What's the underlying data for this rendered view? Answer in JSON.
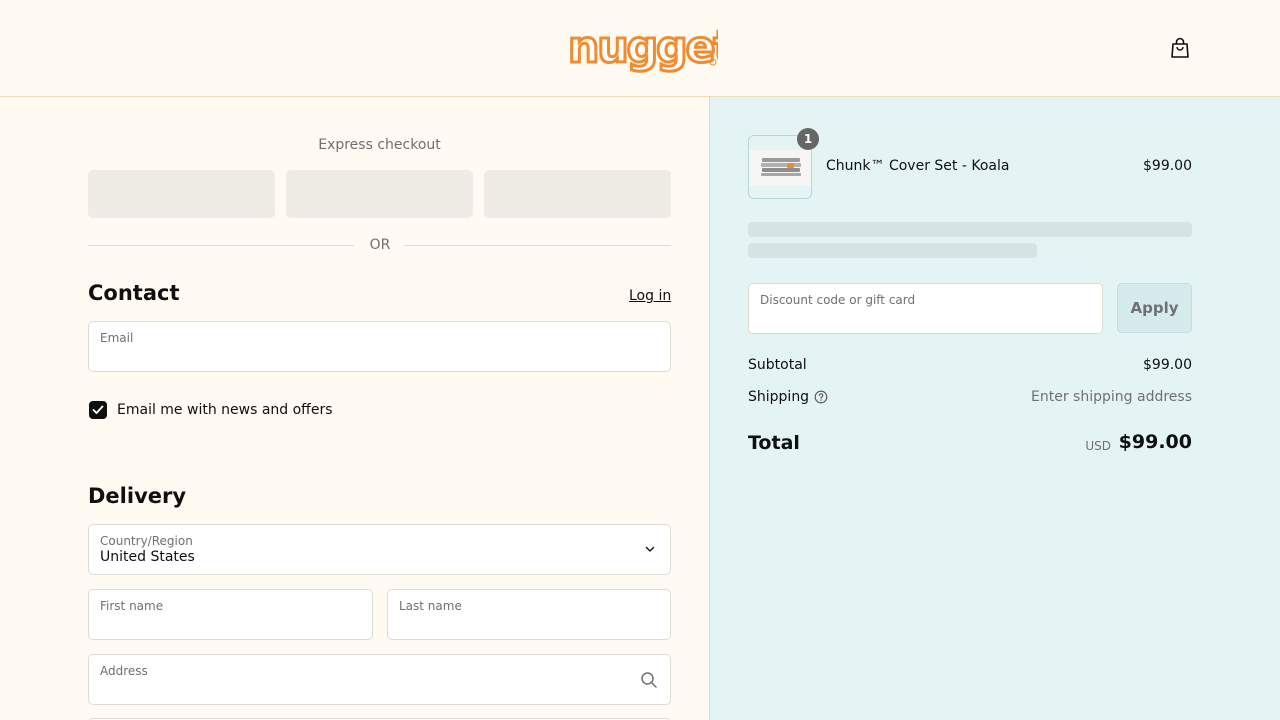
{
  "header": {
    "logo_text": "nugget",
    "cart_icon": "shopping-bag-icon"
  },
  "express": {
    "title": "Express checkout",
    "or_label": "OR"
  },
  "contact": {
    "title": "Contact",
    "login_label": "Log in",
    "email_label": "Email",
    "email_value": "",
    "newsletter_label": "Email me with news and offers",
    "newsletter_checked": true
  },
  "delivery": {
    "title": "Delivery",
    "country_label": "Country/Region",
    "country_value": "United States",
    "first_name_label": "First name",
    "last_name_label": "Last name",
    "address_label": "Address"
  },
  "summary": {
    "item": {
      "name": "Chunk™ Cover Set - Koala",
      "price": "$99.00",
      "quantity": "1"
    },
    "discount_placeholder": "Discount code or gift card",
    "apply_label": "Apply",
    "subtotal_label": "Subtotal",
    "subtotal_value": "$99.00",
    "shipping_label": "Shipping",
    "shipping_value": "Enter shipping address",
    "total_label": "Total",
    "currency": "USD",
    "total_value": "$99.00"
  },
  "colors": {
    "brand_orange": "#f28a2e",
    "page_bg": "#fffbf2",
    "summary_bg": "#e4f3f3"
  }
}
